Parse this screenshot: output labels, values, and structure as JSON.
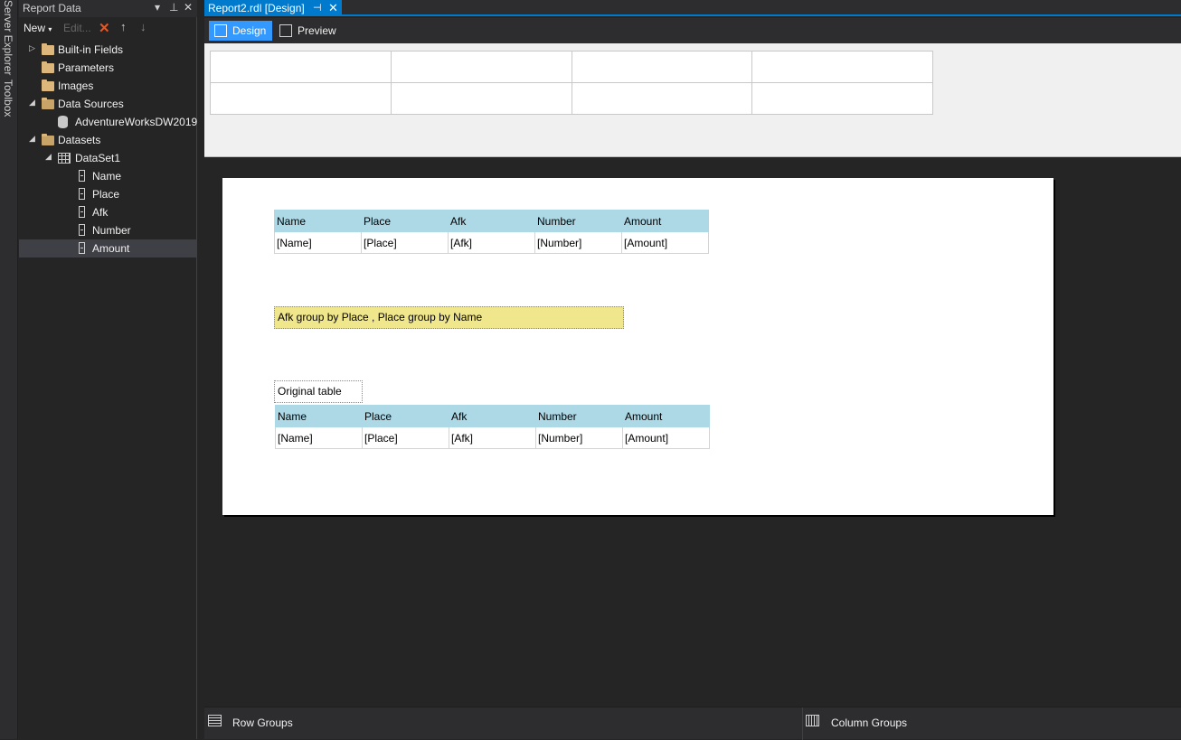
{
  "side_tabs": [
    "Server Explorer",
    "Toolbox"
  ],
  "panel": {
    "title": "Report Data",
    "toolbar": {
      "new_label": "New",
      "edit_label": "Edit..."
    },
    "tree": {
      "built_in_fields": "Built-in Fields",
      "parameters": "Parameters",
      "images": "Images",
      "data_sources": "Data Sources",
      "data_source_item": "AdventureWorksDW2019",
      "datasets": "Datasets",
      "dataset1": "DataSet1",
      "fields": [
        "Name",
        "Place",
        "Afk",
        "Number",
        "Amount"
      ],
      "selected_field": "Amount"
    }
  },
  "document": {
    "tab_title": "Report2.rdl [Design]",
    "modes": {
      "design": "Design",
      "preview": "Preview"
    }
  },
  "report": {
    "table1": {
      "headers": [
        "Name",
        "Place",
        "Afk",
        "Number",
        "Amount"
      ],
      "details": [
        "[Name]",
        "[Place]",
        "[Afk]",
        "[Number]",
        "[Amount]"
      ]
    },
    "textbox_yellow": "Afk group by Place , Place group by Name",
    "textbox_caption": "Original table",
    "table2": {
      "headers": [
        "Name",
        "Place",
        "Afk",
        "Number",
        "Amount"
      ],
      "details": [
        "[Name]",
        "[Place]",
        "[Afk]",
        "[Number]",
        "[Amount]"
      ]
    }
  },
  "groups": {
    "row_groups": "Row Groups",
    "column_groups": "Column Groups"
  },
  "colors": {
    "accent": "#007acc",
    "header_fill": "#add8e6",
    "textbox_fill": "#f0e68c"
  }
}
